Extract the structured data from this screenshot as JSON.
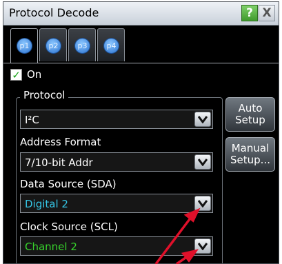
{
  "window": {
    "title": "Protocol Decode",
    "help_label": "?",
    "close_label": "X"
  },
  "tabs": [
    {
      "label": "p1",
      "active": true
    },
    {
      "label": "p2",
      "active": false
    },
    {
      "label": "p3",
      "active": false
    },
    {
      "label": "p4",
      "active": false
    }
  ],
  "on_checkbox": {
    "label": "On",
    "checked": true
  },
  "protocol_group": {
    "label": "Protocol"
  },
  "fields": [
    {
      "label": "",
      "value": "I²C",
      "value_color": "#ffffff"
    },
    {
      "label": "Address Format",
      "value": "7/10-bit Addr",
      "value_color": "#ffffff"
    },
    {
      "label": "Data Source (SDA)",
      "value": "Digital 2",
      "value_color": "#35c6e6"
    },
    {
      "label": "Clock Source (SCL)",
      "value": "Channel 2",
      "value_color": "#37d22c"
    }
  ],
  "buttons": {
    "auto_setup_line1": "Auto",
    "auto_setup_line2": "Setup",
    "manual_setup_line1": "Manual",
    "manual_setup_line2": "Setup..."
  },
  "colors": {
    "annotation_arrow": "#e0102a",
    "window_bg": "#000000"
  }
}
